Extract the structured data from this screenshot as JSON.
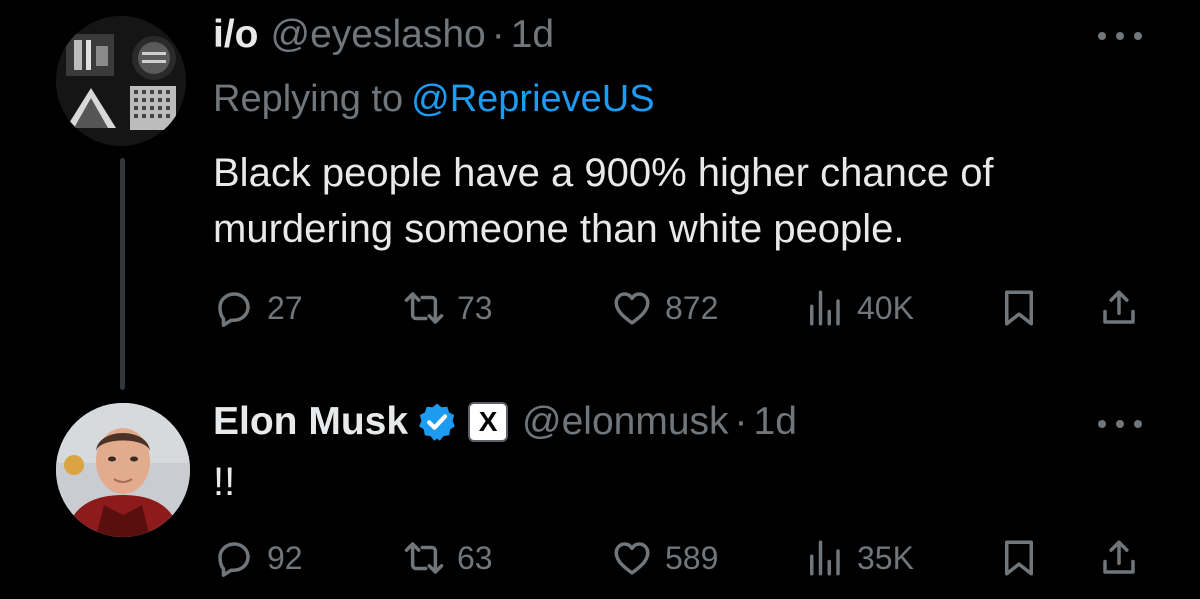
{
  "tweets": [
    {
      "display_name": "i/o",
      "handle": "@eyeslasho",
      "separator": "·",
      "time": "1d",
      "replying_to_label": "Replying to",
      "replying_to_handle": "@ReprieveUS",
      "text": "Black people have a 900% higher chance of murdering someone than white people.",
      "actions": {
        "replies": "27",
        "reposts": "73",
        "likes": "872",
        "views": "40K"
      }
    },
    {
      "display_name": "Elon Musk",
      "verified": true,
      "affiliate_badge": "X",
      "handle": "@elonmusk",
      "separator": "·",
      "time": "1d",
      "text": "!!",
      "actions": {
        "replies": "92",
        "reposts": "63",
        "likes": "589",
        "views": "35K"
      }
    }
  ],
  "icons": {
    "reply": "speech-bubble-icon",
    "repost": "repost-arrows-icon",
    "like": "heart-icon",
    "views": "bar-chart-icon",
    "bookmark": "bookmark-icon",
    "share": "share-upload-icon",
    "more": "three-dots-icon",
    "verified": "verified-badge-icon"
  },
  "colors": {
    "background": "#000000",
    "primary_text": "#e7e9ea",
    "secondary_text": "#71767b",
    "link": "#1d9bf0",
    "verified": "#1d9bf0"
  }
}
